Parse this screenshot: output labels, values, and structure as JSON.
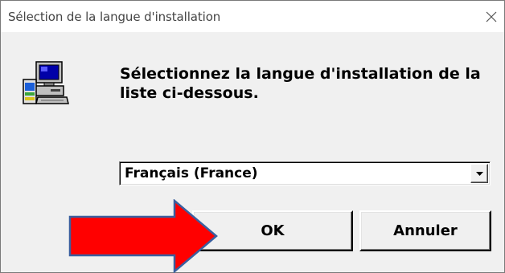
{
  "window": {
    "title": "Sélection de la langue d'installation",
    "close_icon": "close-icon"
  },
  "dialog": {
    "icon": "setup-computer-icon",
    "message_line1": "Sélectionnez la langue d'installation de la",
    "message_line2": "liste ci-dessous.",
    "language_select": {
      "selected": "Français (France)",
      "arrow_icon": "dropdown-arrow-icon"
    },
    "buttons": {
      "ok_label": "OK",
      "cancel_label": "Annuler"
    }
  },
  "annotation": {
    "arrow_icon": "red-arrow-icon",
    "arrow_color": "#ff0000",
    "arrow_border_color": "#3a5f9f"
  }
}
